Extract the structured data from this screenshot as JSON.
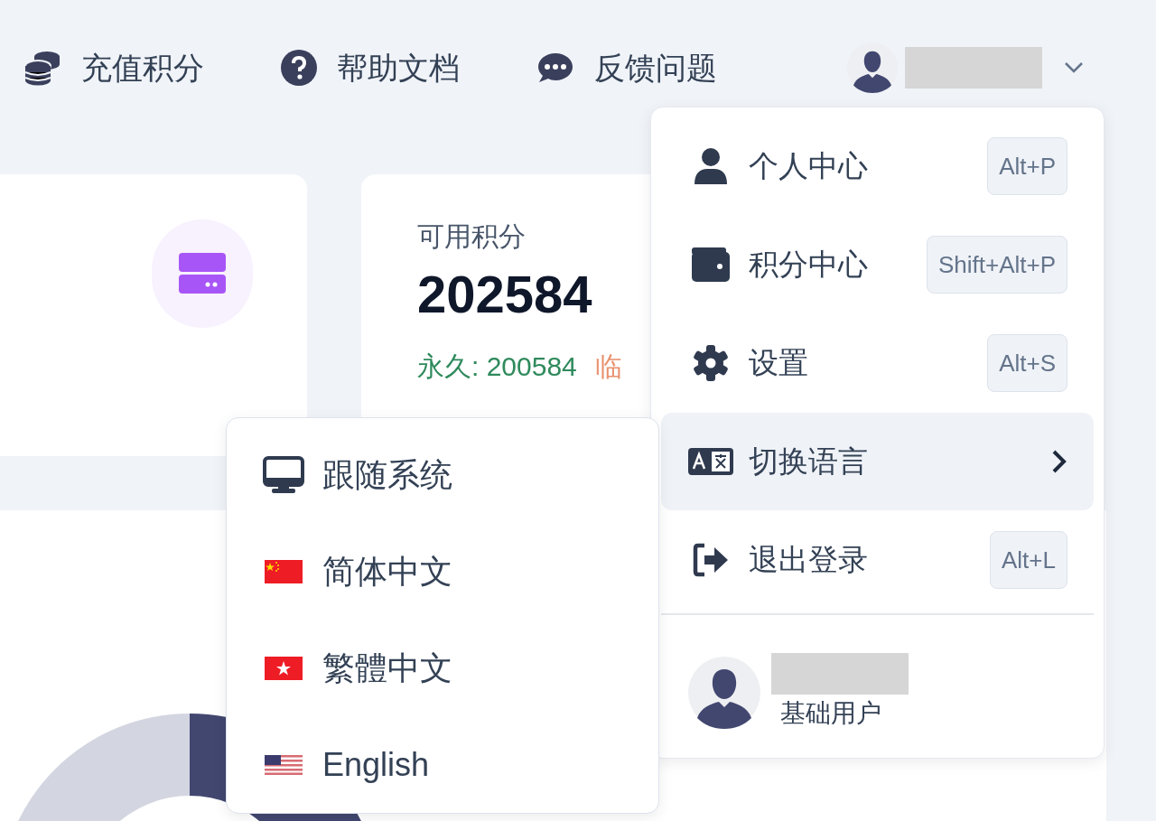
{
  "top_nav": [
    {
      "kind": "coins",
      "label": "充值积分"
    },
    {
      "kind": "help",
      "label": "帮助文档"
    },
    {
      "kind": "chat",
      "label": "反馈问题"
    }
  ],
  "user_menu_button": {
    "expanded": true
  },
  "stats": {
    "label": "可用积分",
    "value": "202584",
    "permanent": "永久: 200584",
    "temporary": "临"
  },
  "user_menu": {
    "items": [
      {
        "kind": "user",
        "label": "个人中心",
        "shortcut": "Alt+P",
        "selected": false
      },
      {
        "kind": "wallet",
        "label": "积分中心",
        "shortcut": "Shift+Alt+P",
        "selected": false
      },
      {
        "kind": "gear",
        "label": "设置",
        "shortcut": "Alt+S",
        "selected": false
      },
      {
        "kind": "language",
        "label": "切换语言",
        "submenu": true,
        "selected": true
      },
      {
        "kind": "logout",
        "label": "退出登录",
        "shortcut": "Alt+L",
        "selected": false
      }
    ],
    "profile": {
      "role": "基础用户"
    }
  },
  "language_menu": [
    {
      "kind": "system",
      "label": "跟随系统"
    },
    {
      "kind": "cn",
      "label": "简体中文"
    },
    {
      "kind": "hk",
      "label": "繁體中文"
    },
    {
      "kind": "us",
      "label": "English"
    }
  ]
}
